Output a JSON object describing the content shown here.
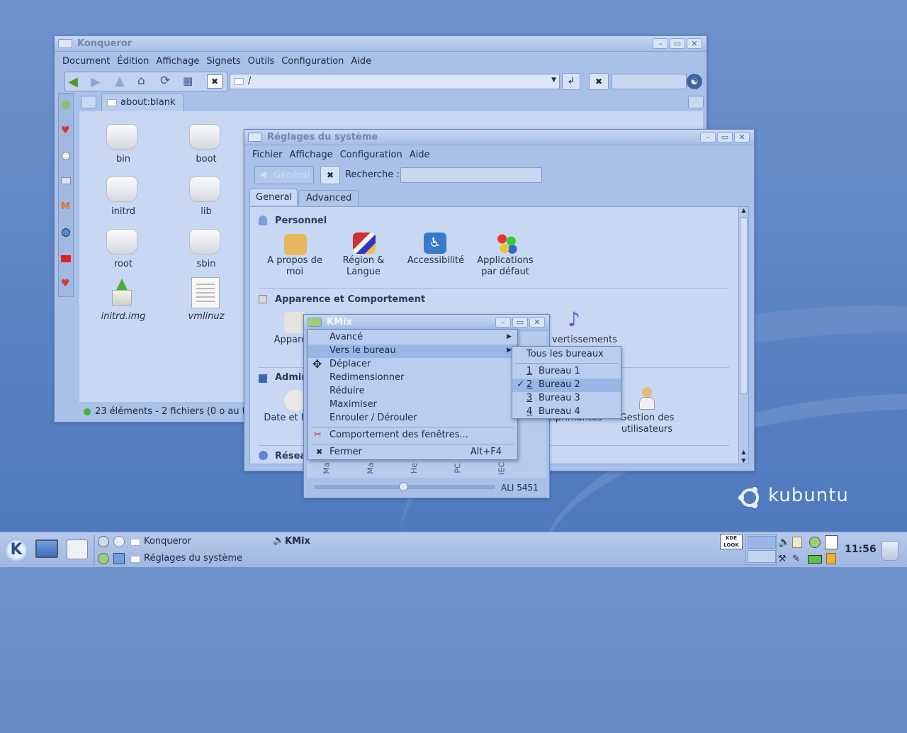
{
  "konqueror": {
    "title": "Konqueror",
    "menu": [
      "Document",
      "Édition",
      "Affichage",
      "Signets",
      "Outils",
      "Configuration",
      "Aide"
    ],
    "location": "/",
    "tab": "about:blank",
    "files": [
      {
        "name": "bin"
      },
      {
        "name": "boot"
      },
      {
        "name": "initrd"
      },
      {
        "name": "lib"
      },
      {
        "name": "root"
      },
      {
        "name": "sbin"
      },
      {
        "name": "initrd.img"
      },
      {
        "name": "vmlinuz"
      }
    ],
    "status": "23 éléments - 2 fichiers (0 o au to"
  },
  "settings": {
    "title": "Réglages du système",
    "menu": [
      "Fichier",
      "Affichage",
      "Configuration",
      "Aide"
    ],
    "back_label": "Général",
    "search_label": "Recherche :",
    "search_placeholder": "",
    "tabs": [
      "General",
      "Advanced"
    ],
    "sections": {
      "personal": "Personnel",
      "appearance": "Apparence et Comportement",
      "admin": "Admin",
      "network": "Résea"
    },
    "personal_items": [
      {
        "label1": "A propos de",
        "label2": "moi"
      },
      {
        "label1": "Région &",
        "label2": "Langue"
      },
      {
        "label1": "Accessibilité",
        "label2": ""
      },
      {
        "label1": "Applications",
        "label2": "par défaut"
      }
    ],
    "appearance_items": {
      "left": "Appare",
      "right": "vertissements"
    },
    "admin_items": {
      "left": "Date et h",
      "right_partial": "mprimantes",
      "users1": "Gestion des",
      "users2": "utilisateurs"
    }
  },
  "kmix": {
    "title": "KMix",
    "channels": [
      "Ma",
      "Ma",
      "He",
      "PC",
      "IEC"
    ],
    "device": "ALI 5451"
  },
  "context_menu": {
    "items": [
      {
        "label": "Avancé",
        "shortcut": "",
        "submenu": true
      },
      {
        "label": "Vers le bureau",
        "shortcut": "",
        "submenu": true
      },
      {
        "label": "Déplacer",
        "shortcut": ""
      },
      {
        "label": "Redimensionner",
        "shortcut": ""
      },
      {
        "label": "Réduire",
        "shortcut": ""
      },
      {
        "label": "Maximiser",
        "shortcut": ""
      },
      {
        "label": "Enrouler / Dérouler",
        "shortcut": ""
      },
      {
        "label": "Comportement des fenêtres...",
        "shortcut": ""
      },
      {
        "label": "Fermer",
        "shortcut": "Alt+F4"
      }
    ]
  },
  "submenu": {
    "all": "Tous les bureaux",
    "desktops": [
      {
        "num": "1",
        "name": "Bureau 1"
      },
      {
        "num": "2",
        "name": "Bureau 2",
        "checked": true
      },
      {
        "num": "3",
        "name": "Bureau 3"
      },
      {
        "num": "4",
        "name": "Bureau 4"
      }
    ]
  },
  "desktop": {
    "logo_text": "kubuntu"
  },
  "taskbar": {
    "tasks": [
      "Konqueror",
      "KMix",
      "Réglages du système"
    ],
    "kde_look": "KDE LOOK",
    "clock": "11:56"
  },
  "colors": {
    "accent": "#9ab6e6",
    "window": "#a9c0e9",
    "desktop": "#5e86c6"
  }
}
